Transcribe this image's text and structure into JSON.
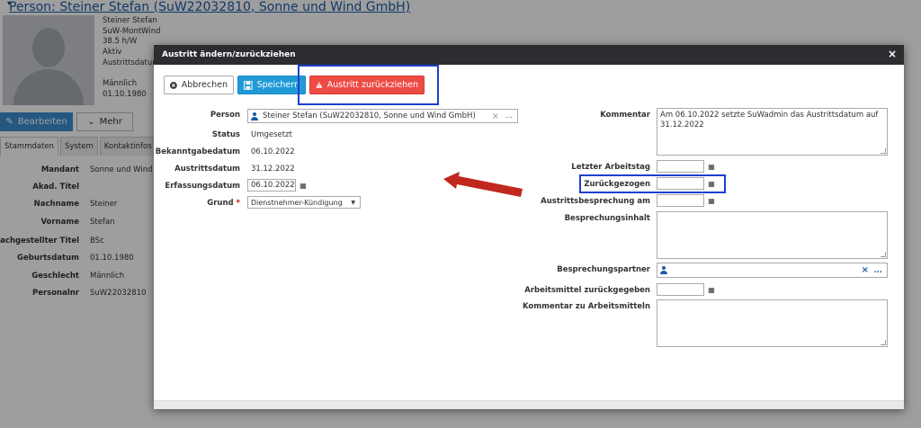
{
  "page": {
    "title": "Person: Steiner Stefan (SuW22032810, Sonne und Wind GmbH)",
    "info_lines": [
      "Steiner Stefan",
      "SuW-MontWind",
      "38.5 h/W",
      "Aktiv",
      "Austrittsdatum",
      "",
      "Männlich",
      "01.10.1980"
    ],
    "edit_button": "Bearbeiten",
    "more_button": "Mehr",
    "tabs": [
      "Stammdaten",
      "System",
      "Kontaktinfos"
    ],
    "fields": [
      {
        "label": "Mandant",
        "value": "Sonne und Wind G"
      },
      {
        "label": "Akad. Titel",
        "value": ""
      },
      {
        "label": "Nachname",
        "value": "Steiner"
      },
      {
        "label": "Vorname",
        "value": "Stefan"
      },
      {
        "label": "Nachgestellter Titel",
        "value": "BSc"
      },
      {
        "label": "Geburtsdatum",
        "value": "01.10.1980"
      },
      {
        "label": "Geschlecht",
        "value": "Männlich"
      },
      {
        "label": "Personalnr",
        "value": "SuW22032810"
      }
    ]
  },
  "modal": {
    "title": "Austritt ändern/zurückziehen",
    "close": "×",
    "toolbar": {
      "cancel": "Abbrechen",
      "save": "Speichern",
      "withdraw": "Austritt zurückziehen"
    },
    "left": {
      "person_label": "Person",
      "person_value": "Steiner Stefan (SuW22032810, Sonne und Wind GmbH)",
      "clear": "×",
      "more": "...",
      "status_label": "Status",
      "status_value": "Umgesetzt",
      "bekanntgabe_label": "Bekanntgabedatum",
      "bekanntgabe_value": "06.10.2022",
      "austritt_label": "Austrittsdatum",
      "austritt_value": "31.12.2022",
      "erfassung_label": "Erfassungsdatum",
      "erfassung_value": "06.10.2022",
      "grund_label": "Grund",
      "required_mark": "*",
      "grund_value": "Dienstnehmer-Kündigung"
    },
    "right": {
      "kommentar_label": "Kommentar",
      "kommentar_value": "Am 06.10.2022 setzte SuWadmin das Austrittsdatum auf 31.12.2022",
      "letzter_label": "Letzter Arbeitstag",
      "zurueck_label": "Zurückgezogen",
      "besprechung_label": "Austrittsbesprechung am",
      "inhalt_label": "Besprechungsinhalt",
      "partner_label": "Besprechungspartner",
      "arbeitsmittel_label": "Arbeitsmittel zurückgegeben",
      "kommentar_arbeitsmittel_label": "Kommentar zu Arbeitsmitteln"
    }
  },
  "colors": {
    "header_bg": "#2b2d30",
    "save": "#1f9ad6",
    "withdraw": "#ee4b45",
    "highlight": "#1d3fd1",
    "arrow": "#c0271d",
    "link": "#1a5ca8"
  }
}
